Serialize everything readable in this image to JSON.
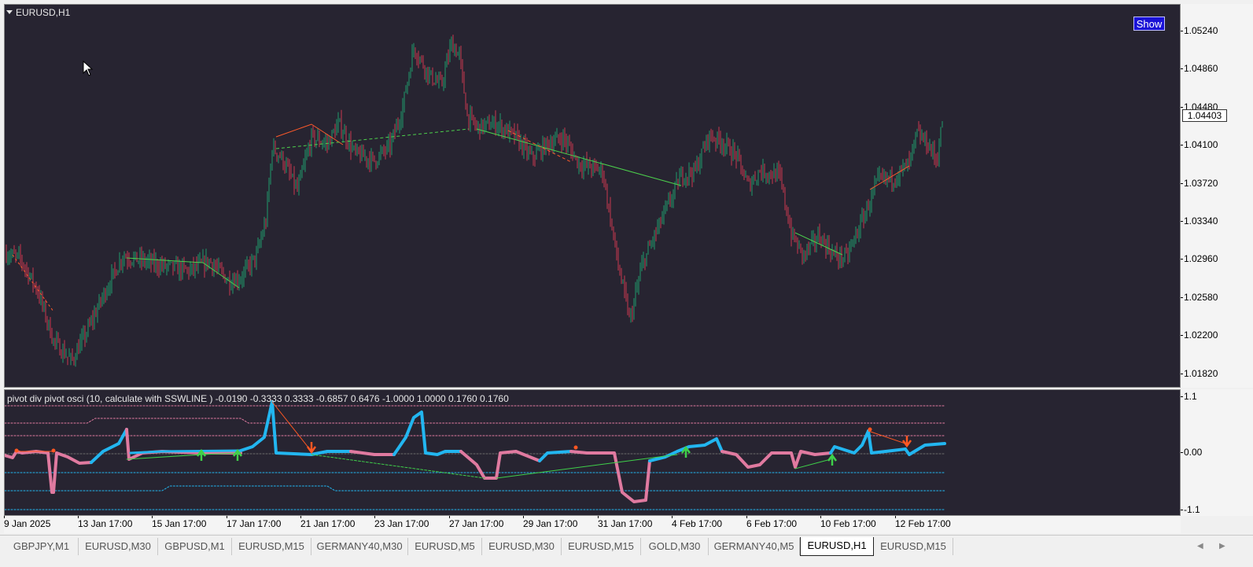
{
  "chart": {
    "symbol_title": "EURUSD,H1",
    "show_button": "Show",
    "current_price": "1.04403",
    "price_ticks": [
      "1.05240",
      "1.04860",
      "1.04480",
      "1.04100",
      "1.03720",
      "1.03340",
      "1.02960",
      "1.02580",
      "1.02200",
      "1.01820"
    ],
    "time_ticks": [
      "9 Jan 2025",
      "13 Jan 17:00",
      "15 Jan 17:00",
      "17 Jan 17:00",
      "21 Jan 17:00",
      "23 Jan 17:00",
      "27 Jan 17:00",
      "29 Jan 17:00",
      "31 Jan 17:00",
      "4 Feb 17:00",
      "6 Feb 17:00",
      "10 Feb 17:00",
      "12 Feb 17:00"
    ],
    "colors": {
      "background": "#272431",
      "bull": "#1f9a6a",
      "bear": "#c8384e",
      "line_bull": "#4cd04c",
      "line_bear": "#ff5a2a"
    }
  },
  "indicator": {
    "title": "pivot div pivot osci (10, calculate with SSWLINE ) -0.0190 -0.3333 0.3333 -0.6857 0.6476 -1.0000 1.0000 0.1760 0.1760",
    "scale_ticks": [
      "1.1",
      "0.00",
      "-1.1"
    ],
    "colors": {
      "up": "#22b6f0",
      "down": "#e07aa0",
      "up_arrow": "#3fd04a",
      "down_arrow": "#ff5722"
    }
  },
  "tabs": [
    {
      "label": "GBPJPY,M1",
      "active": false
    },
    {
      "label": "EURUSD,M30",
      "active": false
    },
    {
      "label": "GBPUSD,M1",
      "active": false
    },
    {
      "label": "EURUSD,M15",
      "active": false
    },
    {
      "label": "GERMANY40,M30",
      "active": false
    },
    {
      "label": "EURUSD,M5",
      "active": false
    },
    {
      "label": "EURUSD,M30",
      "active": false
    },
    {
      "label": "EURUSD,M15",
      "active": false
    },
    {
      "label": "GOLD,M30",
      "active": false
    },
    {
      "label": "GERMANY40,M5",
      "active": false
    },
    {
      "label": "EURUSD,H1",
      "active": true
    },
    {
      "label": "EURUSD,M15",
      "active": false
    }
  ],
  "icons": {
    "collapse": "triangle-down-icon",
    "cursor": "mouse-pointer-icon",
    "scroll_left": "chevron-left-icon",
    "scroll_right": "chevron-right-icon"
  }
}
